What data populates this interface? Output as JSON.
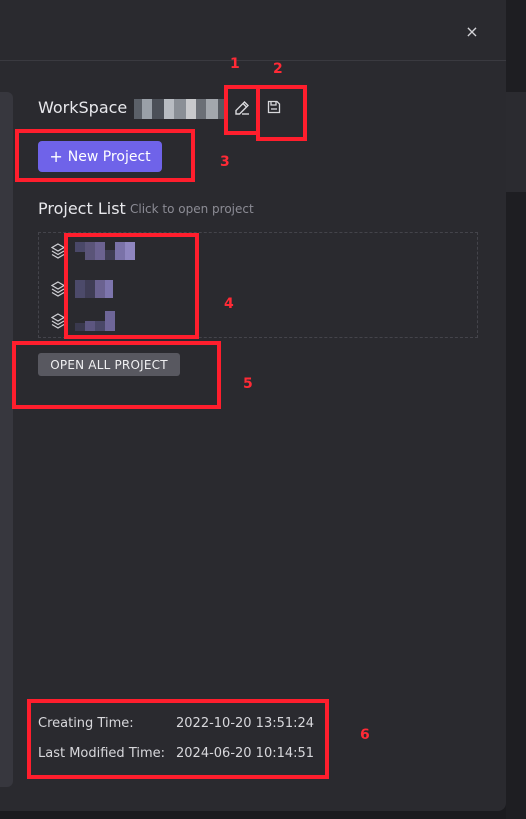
{
  "dialog": {
    "close_symbol": "×"
  },
  "workspace": {
    "label": "WorkSpace :",
    "edit_icon": "pencil-icon",
    "save_icon": "save-icon"
  },
  "actions": {
    "new_project_label": "New Project",
    "new_project_icon": "plus-icon"
  },
  "project_list": {
    "title": "Project List",
    "hint": "Click to open project",
    "item_icon": "layers-icon",
    "open_all_label": "OPEN ALL PROJECT"
  },
  "meta": {
    "creating_label": "Creating Time:",
    "creating_value": "2022-10-20 13:51:24",
    "modified_label": "Last Modified Time:",
    "modified_value": "2024-06-20 10:14:51"
  },
  "annotations": [
    "1",
    "2",
    "3",
    "4",
    "5",
    "6"
  ],
  "colors": {
    "accent": "#6f63e9",
    "annotation": "#ff1e2d",
    "panel": "#2a2a2f"
  }
}
